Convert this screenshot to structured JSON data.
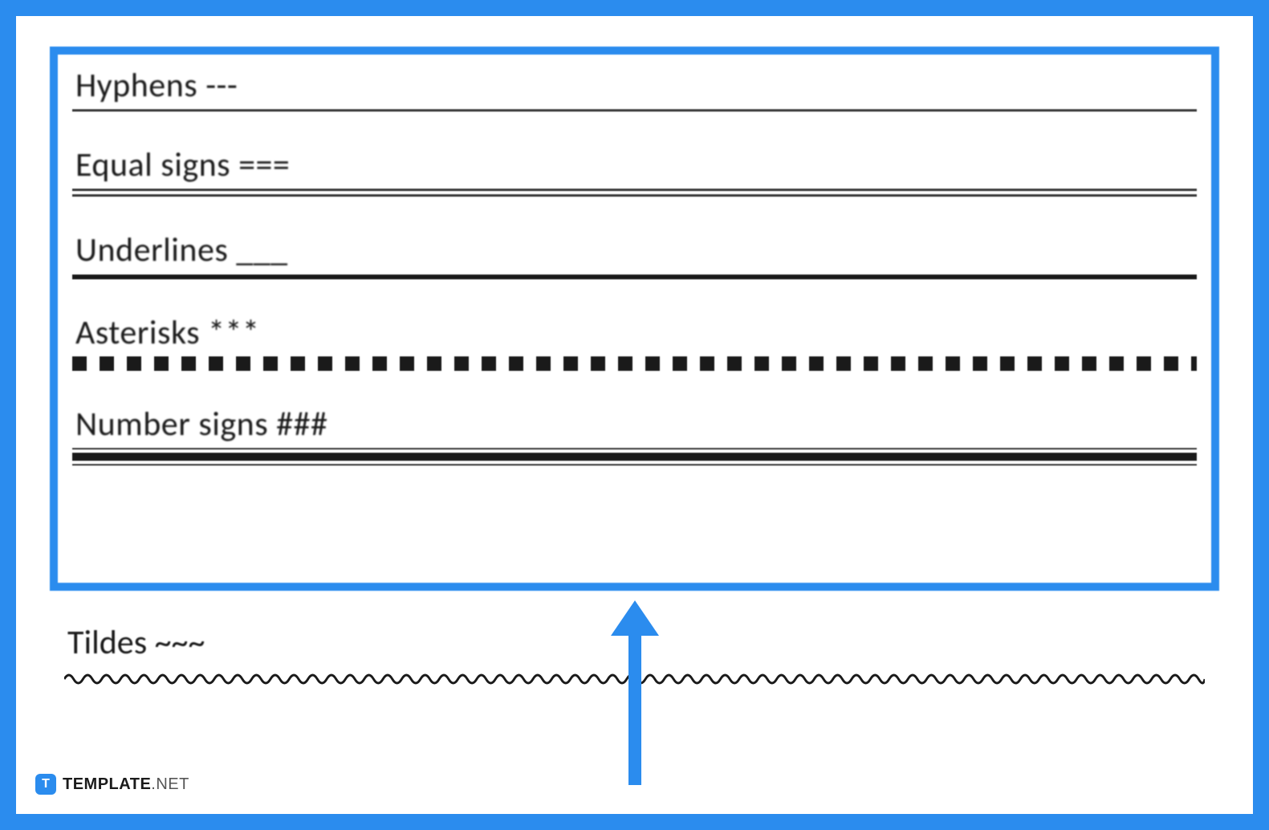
{
  "document": {
    "rows": [
      {
        "label": "Hyphens ---",
        "style": "hyphens"
      },
      {
        "label": "Equal signs ===",
        "style": "equals"
      },
      {
        "label": "Underlines ___",
        "style": "underlines"
      },
      {
        "label": "Asterisks ***",
        "style": "asterisks"
      },
      {
        "label": "Number signs ###",
        "style": "numbersigns"
      }
    ],
    "outside_row": {
      "label": "Tildes ~~~",
      "style": "tildes"
    }
  },
  "branding": {
    "logo_letter": "T",
    "name_bold": "TEMPLATE",
    "name_light": ".NET"
  },
  "accent_color": "#2b8cee"
}
